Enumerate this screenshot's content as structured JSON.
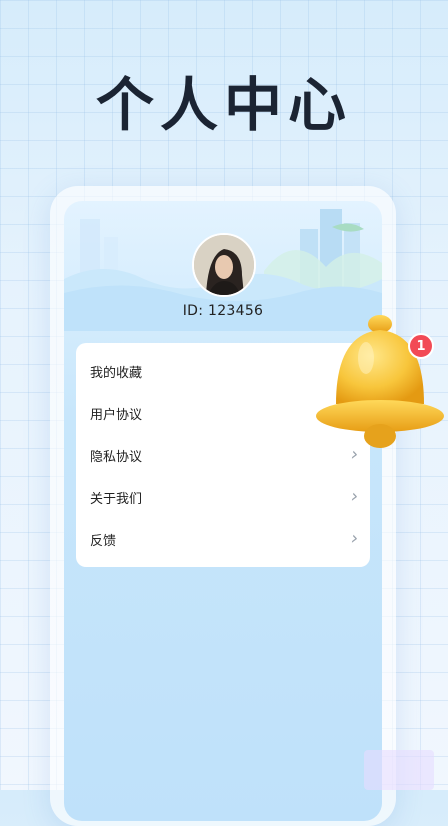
{
  "headline": "个人中心",
  "profile": {
    "user_id": "ID: 123456"
  },
  "menu": {
    "items": [
      {
        "label": "我的收藏",
        "has_chevron": false
      },
      {
        "label": "用户协议",
        "has_chevron": false
      },
      {
        "label": "隐私协议",
        "has_chevron": true
      },
      {
        "label": "关于我们",
        "has_chevron": true
      },
      {
        "label": "反馈",
        "has_chevron": true
      }
    ]
  },
  "notification": {
    "icon": "bell-icon",
    "count": "1"
  },
  "colors": {
    "accent": "#f24a55",
    "bell": "#f6c53a",
    "headline": "#1b2433"
  }
}
